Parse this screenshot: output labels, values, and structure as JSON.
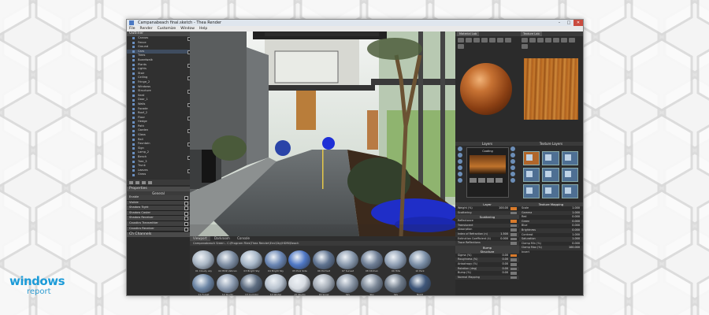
{
  "window": {
    "title": "Campanabeach final.sketch - Thea Render",
    "buttons": [
      "–",
      "□",
      "✕"
    ]
  },
  "menu": [
    "File",
    "Render",
    "Customize",
    "Window",
    "Help"
  ],
  "scene_panel": {
    "header": "Outliner",
    "items": [
      "Canvas",
      "Fence",
      "Ground",
      "Cars",
      "Trees",
      "Boardwalk",
      "Plants",
      "Lights",
      "Stair",
      "Ceiling",
      "Fringe_2",
      "Windows",
      "Structure",
      "Seat",
      "Door_1",
      "Walls",
      "Facade",
      "Roof_2",
      "Floor",
      "Hedge",
      "Path",
      "Garden",
      "Glass",
      "Rail",
      "Fountain",
      "Sign",
      "Lamp_2",
      "Bench",
      "Tree_3",
      "Trunk",
      "Leaves",
      "Grass",
      "Flowers",
      "Sky",
      "Cam_01",
      "Cam_02",
      "Lamp Post",
      "Decals",
      "Group_Tree"
    ]
  },
  "properties_panel": {
    "header": "Properties",
    "subheader": "General",
    "rows": [
      "Enable",
      "Visible",
      "Shadow Tight",
      "Shadow Caster",
      "Shadow Receiver",
      "Caustics Transmitter",
      "Caustics Receiver"
    ],
    "footer": "Ch Channels"
  },
  "viewport_tabs": [
    "Viewport",
    "Darkroom",
    "Console"
  ],
  "browser": {
    "path": "Campanabeach Sreen - C:\\Program Files\\Thea Render\\Env\\Sky\\HDRI\\Beach",
    "thumbs": [
      {
        "cap": "01 Cloudy sky",
        "color": "#a9b6c4"
      },
      {
        "cap": "02 HDR Vatican",
        "color": "#7f8fa4"
      },
      {
        "cap": "03 Bright Sky",
        "color": "#a7b7c8"
      },
      {
        "cap": "04 Bright Sky",
        "color": "#6a86b4"
      },
      {
        "cap": "05 Pool Side",
        "color": "#4f78c6"
      },
      {
        "cap": "06 Portrait",
        "color": "#5f7390"
      },
      {
        "cap": "07 Sunset",
        "color": "#8a9aae"
      },
      {
        "cap": "08 Kitchen",
        "color": "#6f7f96"
      },
      {
        "cap": "09 Hills",
        "color": "#90a0b5"
      },
      {
        "cap": "10 Park",
        "color": "#7c90a8"
      },
      {
        "cap": "11 Forest",
        "color": "#6d86a5"
      },
      {
        "cap": "12 Studio",
        "color": "#8c9bb0"
      },
      {
        "cap": "13 Corridor",
        "color": "#5d6c80"
      },
      {
        "cap": "14 Winter",
        "color": "#b9c3cf"
      },
      {
        "cap": "15 Studio",
        "color": "#d6dbe1"
      },
      {
        "cap": "16 Snow",
        "color": "#a4acb6"
      },
      {
        "cap": "Sky",
        "color": "#8a96a6"
      },
      {
        "cap": "Sky",
        "color": "#7c8897"
      },
      {
        "cap": "Sky",
        "color": "#6f7b8a"
      },
      {
        "cap": "Night",
        "color": "#3e5679"
      }
    ]
  },
  "material_panel": {
    "tabs": [
      "Material Lab"
    ],
    "layers_title": "Layers",
    "layer_name": "Coating",
    "props": {
      "head": "Layer",
      "rows": [
        {
          "label": "Weight (%)",
          "value": "100.00"
        },
        {
          "label": "Scattering",
          "value": ""
        }
      ],
      "sub1": "Scattering",
      "rows2": [
        {
          "label": "Reflectance",
          "value": ""
        },
        {
          "label": "Translucent",
          "value": ""
        },
        {
          "label": "Absorption",
          "value": ""
        },
        {
          "label": "Index of Refraction (n)",
          "value": "1.500"
        },
        {
          "label": "Extinction Coefficient (k)",
          "value": "0.000"
        },
        {
          "label": "Trace Reflections",
          "value": ""
        }
      ],
      "sub2": "Bump",
      "sub3": "Structure",
      "rows3": [
        {
          "label": "Sigma (%)",
          "value": "0.00"
        },
        {
          "label": "Roughness (%)",
          "value": "0.00"
        },
        {
          "label": "Anisotropy (%)",
          "value": "0.00"
        },
        {
          "label": "Rotation (deg)",
          "value": "0.00"
        },
        {
          "label": "Bump (%)",
          "value": "0.00"
        },
        {
          "label": "Normal Mapping",
          "value": ""
        }
      ]
    }
  },
  "texture_panel": {
    "tabs": [
      "Texture Lab"
    ],
    "title": "Texture Layers",
    "mapping_title": "Texture Mapping",
    "rows": [
      {
        "label": "Scale",
        "value": "1.000"
      },
      {
        "label": "Gamma",
        "value": "1.000"
      },
      {
        "label": "Red",
        "value": "0.000"
      },
      {
        "label": "Green",
        "value": "0.000"
      },
      {
        "label": "Blue",
        "value": "0.000"
      },
      {
        "label": "Brightness",
        "value": "0.000"
      },
      {
        "label": "Contrast",
        "value": "1.000"
      },
      {
        "label": "Saturation",
        "value": "1.000"
      },
      {
        "label": "Clamp Min (%)",
        "value": "0.000"
      },
      {
        "label": "Clamp Max (%)",
        "value": "100.000"
      },
      {
        "label": "Invert",
        "value": ""
      }
    ]
  },
  "logo": {
    "line1": "windows",
    "line2": "report"
  },
  "colors": {
    "app_bg": "#2a2a2a",
    "panel_header": "#4a4a4a",
    "wood": "#b5651d",
    "logo_blue": "#1c9bd8",
    "scene_blue_flowers": "#1e2fd6"
  }
}
